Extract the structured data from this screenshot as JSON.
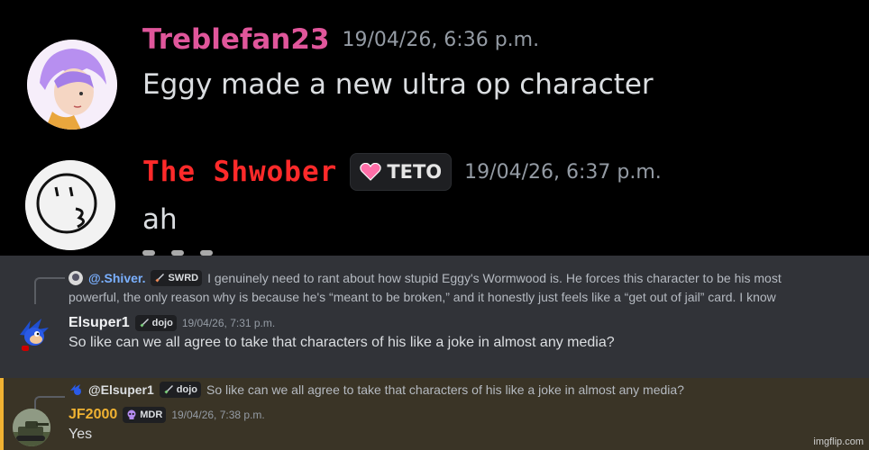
{
  "top_messages": [
    {
      "author": "Treblefan23",
      "author_color": "#e0569b",
      "timestamp": "19/04/26, 6:36 p.m.",
      "text": "Eggy made a new ultra op character"
    },
    {
      "author": "The Shwober",
      "author_color": "#ff2a2a",
      "tag_icon": "heart-icon",
      "tag": "TETO",
      "timestamp": "19/04/26, 6:37 p.m.",
      "text": "ah"
    }
  ],
  "message_1": {
    "reply": {
      "author": "@.Shiver.",
      "tag_icon": "sword-icon",
      "tag": "SWRD",
      "text_line1": "I genuinely need to rant about how stupid Eggy's Wormwood is. He forces this character to be his most",
      "text_line2": "powerful, the only reason why is because he's “meant to be broken,” and it honestly just feels like a “get out of jail” card. I know"
    },
    "author": "Elsuper1",
    "tag_icon": "sword-icon",
    "tag": "dojo",
    "timestamp": "19/04/26, 7:31 p.m.",
    "text": "So like can we all agree to take that characters of his like a joke in almost any media?"
  },
  "message_2": {
    "reply": {
      "author": "@Elsuper1",
      "tag_icon": "sword-icon",
      "tag": "dojo",
      "text": "So like can we all agree to take that characters of his like a joke in almost any media?"
    },
    "author": "JF2000",
    "author_color": "#f0b232",
    "tag_icon": "skull-icon",
    "tag": "MDR",
    "timestamp": "19/04/26, 7:38 p.m.",
    "text": "Yes"
  },
  "watermark": "imgflip.com",
  "colors": {
    "highlight_bg": "#3a3426",
    "highlight_bar": "#f0b232",
    "mention": "#7ab0ff"
  }
}
